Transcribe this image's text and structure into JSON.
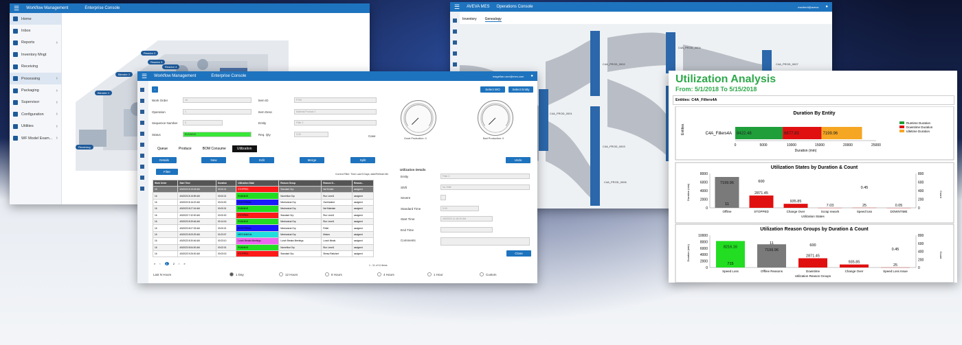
{
  "win1": {
    "app_title": "Workflow Management",
    "console": "Enterprise Console",
    "nav": [
      {
        "label": "Home",
        "chev": false
      },
      {
        "label": "Inbox",
        "chev": false
      },
      {
        "label": "Reports",
        "chev": true
      },
      {
        "label": "Inventory Mngt",
        "chev": false
      },
      {
        "label": "Receiving",
        "chev": false
      },
      {
        "label": "Processing",
        "chev": true
      },
      {
        "label": "Packaging",
        "chev": true
      },
      {
        "label": "Supervisor",
        "chev": true
      },
      {
        "label": "Configuration",
        "chev": true
      },
      {
        "label": "Utilities",
        "chev": true
      },
      {
        "label": "WF Model Exam...",
        "chev": true
      }
    ],
    "map_labels": [
      "Reactor 2",
      "Reactor 3",
      "Blender 2",
      "Blender 1",
      "Reactor 4",
      "Receiving"
    ]
  },
  "win2": {
    "app_title": "AVEVA MES",
    "console": "Operations Console",
    "user": "manfredi@aveva",
    "tabs": [
      "Inventory",
      "Genealogy"
    ],
    "node_labels": [
      "C4A_PROD_0001",
      "C4A_PROD_0002",
      "C4A_PROD_0003",
      "C4A_PROD_0004",
      "C4A_PROD_0005",
      "C4A_PROD_0006",
      "C4A_PROD_0007"
    ]
  },
  "win3": {
    "app_title": "Workflow Management",
    "console": "Enterprise Console",
    "user": "magellan.user@mes.com",
    "select_wo": "Select WO",
    "select_entity": "Select Entity",
    "form": [
      {
        "label": "Work Order",
        "value": "16"
      },
      {
        "label": "Operation",
        "value": "1"
      },
      {
        "label": "Sequence Number",
        "value": "0"
      },
      {
        "label": "Status",
        "value": "RUNNING"
      }
    ],
    "form2": [
      {
        "label": "Item ID",
        "value": "P700"
      },
      {
        "label": "Item Desc",
        "value": "Material Product 1"
      },
      {
        "label": "Entity",
        "value": "Filler 2"
      },
      {
        "label": "Req. Qty",
        "value": "3.00"
      }
    ],
    "case_label": "Case",
    "gauge1_label": "Good Production: 0",
    "gauge2_label": "Bad Production: 0",
    "tabs": [
      "Queue",
      "Produce",
      "BOM Consume",
      "Utilization"
    ],
    "actions": [
      "Details",
      "New",
      "Edit",
      "Merge",
      "Split",
      "Undo"
    ],
    "filter_btn": "Filter",
    "filter_text": "Current Filter: Time Last 5 Days; date/Refresh Mn",
    "columns": [
      "Work Order",
      "Start Time",
      "Duration",
      "Utilization State",
      "Reason Group",
      "Reason D...",
      "Reason..."
    ],
    "rows": [
      {
        "wo": "16",
        "time": "4/5/2023 8:15:18 AM",
        "dur": "00:00:21",
        "state": "STOPPED",
        "color": "#ff1a1a",
        "group": "Standard Grp",
        "rd": "Not Ended",
        "r": "assigned"
      },
      {
        "wo": "16",
        "time": "4/5/2023 8:15:59 AM",
        "dur": "00:00:21",
        "state": "RUNNING",
        "color": "#22dd22",
        "group": "Nonreflow Grp",
        "rd": "Run Level1",
        "r": "assigned"
      },
      {
        "wo": "16",
        "time": "4/5/2023 8:16:22 AM",
        "dur": "00:04:00",
        "state": "ELECTRICAL",
        "color": "#1a1aff",
        "group": "Mechanical Grp",
        "rd": "Overheated",
        "r": "assigned"
      },
      {
        "wo": "16",
        "time": "4/5/2023 8:27:16 AM",
        "dur": "00:00:01",
        "state": "RUNNING",
        "color": "#22dd22",
        "group": "Mechanical Grp",
        "rd": "Not Maintain",
        "r": "assigned"
      },
      {
        "wo": "16",
        "time": "4/5/2023 7:32:00 AM",
        "dur": "00:00:00",
        "state": "STOPPED",
        "color": "#ff1a1a",
        "group": "Standard Grp",
        "rd": "Run Level1",
        "r": "assigned"
      },
      {
        "wo": "16",
        "time": "4/5/2023 8:39:46 AM",
        "dur": "00:14:16",
        "state": "RUNNING",
        "color": "#22dd22",
        "group": "Mechanical Grp",
        "rd": "Run Level1",
        "r": "assigned"
      },
      {
        "wo": "16",
        "time": "4/5/2023 8:07:33 AM",
        "dur": "00:00:01",
        "state": "ELECTRICAL",
        "color": "#1a1aff",
        "group": "Mechanical Grp",
        "rd": "Pellet",
        "r": "assigned"
      },
      {
        "wo": "16",
        "time": "4/5/2023 8:09:29 AM",
        "dur": "00:23:07",
        "state": "MECHANICAL",
        "color": "#22dddd",
        "group": "Mechanical Grp",
        "rd": "Motors",
        "r": "assigned"
      },
      {
        "wo": "16",
        "time": "4/5/2023 8:30:46 AM",
        "dur": "00:23:10",
        "state": "Lunch Breaks Meetings",
        "color": "#ee66ee",
        "group": "Lunch Breaks Meetings",
        "rd": "Lunch Meals",
        "r": "assigned"
      },
      {
        "wo": "16",
        "time": "4/5/2023 8:54:00 AM",
        "dur": "00:02:01",
        "state": "RUNNING",
        "color": "#22dd22",
        "group": "Nonreflow Grp",
        "rd": "Run Level1",
        "r": "assigned"
      },
      {
        "wo": "16",
        "time": "4/5/2023 9:26:00 AM",
        "dur": "00:03:15",
        "state": "STOPPED",
        "color": "#ff1a1a",
        "group": "Standard Grp",
        "rd": "Sheep Ratio/set",
        "r": "assigned"
      }
    ],
    "pager": "1 - 11 of 11 items",
    "pages": [
      "1",
      "2"
    ],
    "ud_title": "Utilization Details",
    "ud_fields": [
      {
        "label": "Entity",
        "value": "Filler 2"
      },
      {
        "label": "Shift",
        "value": "No Shift"
      },
      {
        "label": "Severe",
        "value": ""
      },
      {
        "label": "Standard Time",
        "value": "5.00"
      },
      {
        "label": "Start Time",
        "value": "4/5/2023 11:18:20 AM"
      },
      {
        "label": "End Time",
        "value": ""
      },
      {
        "label": "Comments",
        "value": ""
      }
    ],
    "close": "Close",
    "last_n": "Last N Hours",
    "radios": [
      "1 Day",
      "12 Hours",
      "8 Hours",
      "4 Hours",
      "1 Hour",
      "Custom"
    ]
  },
  "win4": {
    "title": "Utilization Analysis",
    "subtitle": "From: 5/1/2018 To 5/15/2018",
    "entities": "Entities: C4A_Fillers4A"
  },
  "chart_data": [
    {
      "type": "bar",
      "title": "Duration By Entity",
      "orientation": "horizontal-stacked",
      "categories": [
        "C4A_Fillers4A"
      ],
      "series": [
        {
          "name": "Runtime Duration",
          "color": "#1f9e3a",
          "values": [
            8422.48
          ]
        },
        {
          "name": "Downtime Duration",
          "color": "#e01010",
          "values": [
            6877.83
          ]
        },
        {
          "name": "Idletime Duration",
          "color": "#f5a623",
          "values": [
            7199.96
          ]
        }
      ],
      "xlabel": "Duration (min)",
      "ylabel": "Entities",
      "xlim": [
        0,
        25000
      ],
      "xticks": [
        0,
        5000,
        10000,
        15000,
        20000,
        25000
      ],
      "legend": "right"
    },
    {
      "type": "bar",
      "title": "Utilization States by Duration & Count",
      "categories": [
        "Offline",
        "STOPPED",
        "Change Over",
        "Scrap rework",
        "Speed loss",
        "DOWNTIME"
      ],
      "values": [
        7199.96,
        2871.45,
        935.85,
        7.03,
        25,
        0.05
      ],
      "value_labels": [
        "7199.96",
        "2871.45",
        "935.85",
        "7.03",
        "25",
        "0.05"
      ],
      "colors": [
        "#7a7a7a",
        "#e01010",
        "#e01010",
        "#e01010",
        "#e01010",
        "#e01010"
      ],
      "count": [
        11,
        600,
        null,
        null,
        0.45,
        null
      ],
      "count_labels": [
        "11",
        "600",
        "",
        "",
        "0.45",
        ""
      ],
      "xlabel": "Utilization States",
      "ylabel": "Duration (min)",
      "y2label": "Count",
      "ylim": [
        0,
        8000
      ],
      "yticks": [
        0,
        2000,
        4000,
        6000,
        8000
      ],
      "y2ticks": [
        0,
        200,
        400,
        600,
        800
      ]
    },
    {
      "type": "bar",
      "title": "Utilization Reason Groups by Duration & Count",
      "categories": [
        "Speed Loss",
        "Offline Reasons",
        "Downtime",
        "Change Over",
        "Speed Loss Issue"
      ],
      "values": [
        8216.16,
        7199.96,
        2871.45,
        935.85,
        25
      ],
      "value_labels": [
        "8216.16",
        "7199.96",
        "2871.45",
        "935.85",
        "25"
      ],
      "colors": [
        "#22dd22",
        "#7a7a7a",
        "#e01010",
        "#e01010",
        "#e01010"
      ],
      "count": [
        715,
        11,
        600,
        null,
        0.45
      ],
      "count_labels": [
        "715",
        "11",
        "600",
        "",
        "0.45"
      ],
      "xlabel": "Utilization Reason Groups",
      "ylabel": "Duration (min)",
      "y2label": "Count",
      "ylim": [
        0,
        10000
      ],
      "yticks": [
        0,
        2000,
        4000,
        6000,
        8000,
        10000
      ],
      "y2ticks": [
        0,
        200,
        400,
        600,
        800
      ]
    }
  ]
}
